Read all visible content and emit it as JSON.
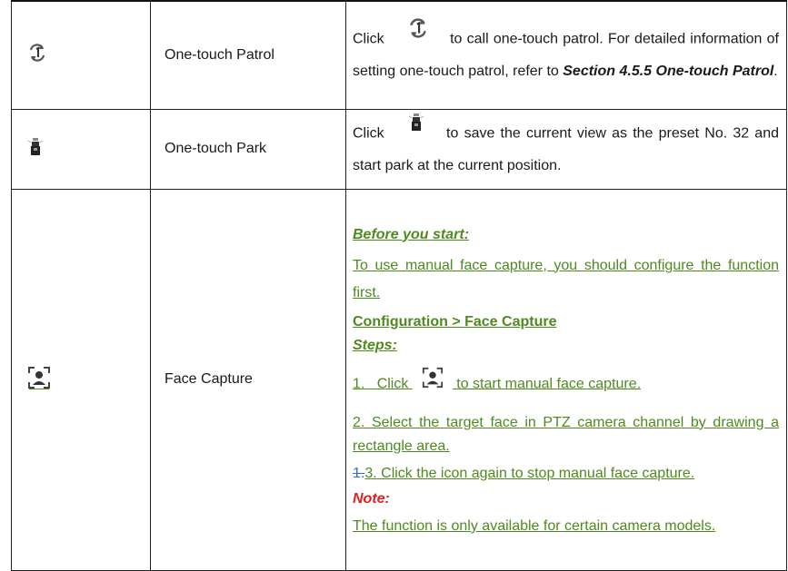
{
  "rows": [
    {
      "icon": "one-touch-patrol-icon",
      "name": "One-touch Patrol",
      "desc": {
        "before_icon": "Click",
        "after_icon": "to call one-touch patrol. For detailed information of setting one-touch patrol, refer to",
        "ref": "Section 4.5.5 One-touch Patrol",
        "end": "."
      }
    },
    {
      "icon": "one-touch-park-icon",
      "name": "One-touch Park",
      "desc": {
        "before_icon": "Click",
        "after_icon": "to save the current view as the preset No. 32 and start park at the current position."
      }
    },
    {
      "icon": "face-capture-icon",
      "name": "Face Capture",
      "desc": {
        "before_start": "Before you start:",
        "prereq": "To use manual face capture, you should configure the function first.",
        "path": "Configuration > Face Capture",
        "steps_label": "Steps:",
        "step1_num": "1.",
        "step1_before": "Click",
        "step1_after": "to start manual face capture.",
        "step2": "2.   Select the target face in PTZ camera channel by drawing a rectangle area.",
        "step3_struck": "1.",
        "step3": "3. Click the icon again to stop manual face capture.",
        "note_label": "Note:",
        "note": "The function is only available for certain camera models."
      }
    }
  ],
  "colors": {
    "inserted": "#4e8a1e",
    "note": "#e21e1e",
    "struck": "#2f6fd1"
  }
}
